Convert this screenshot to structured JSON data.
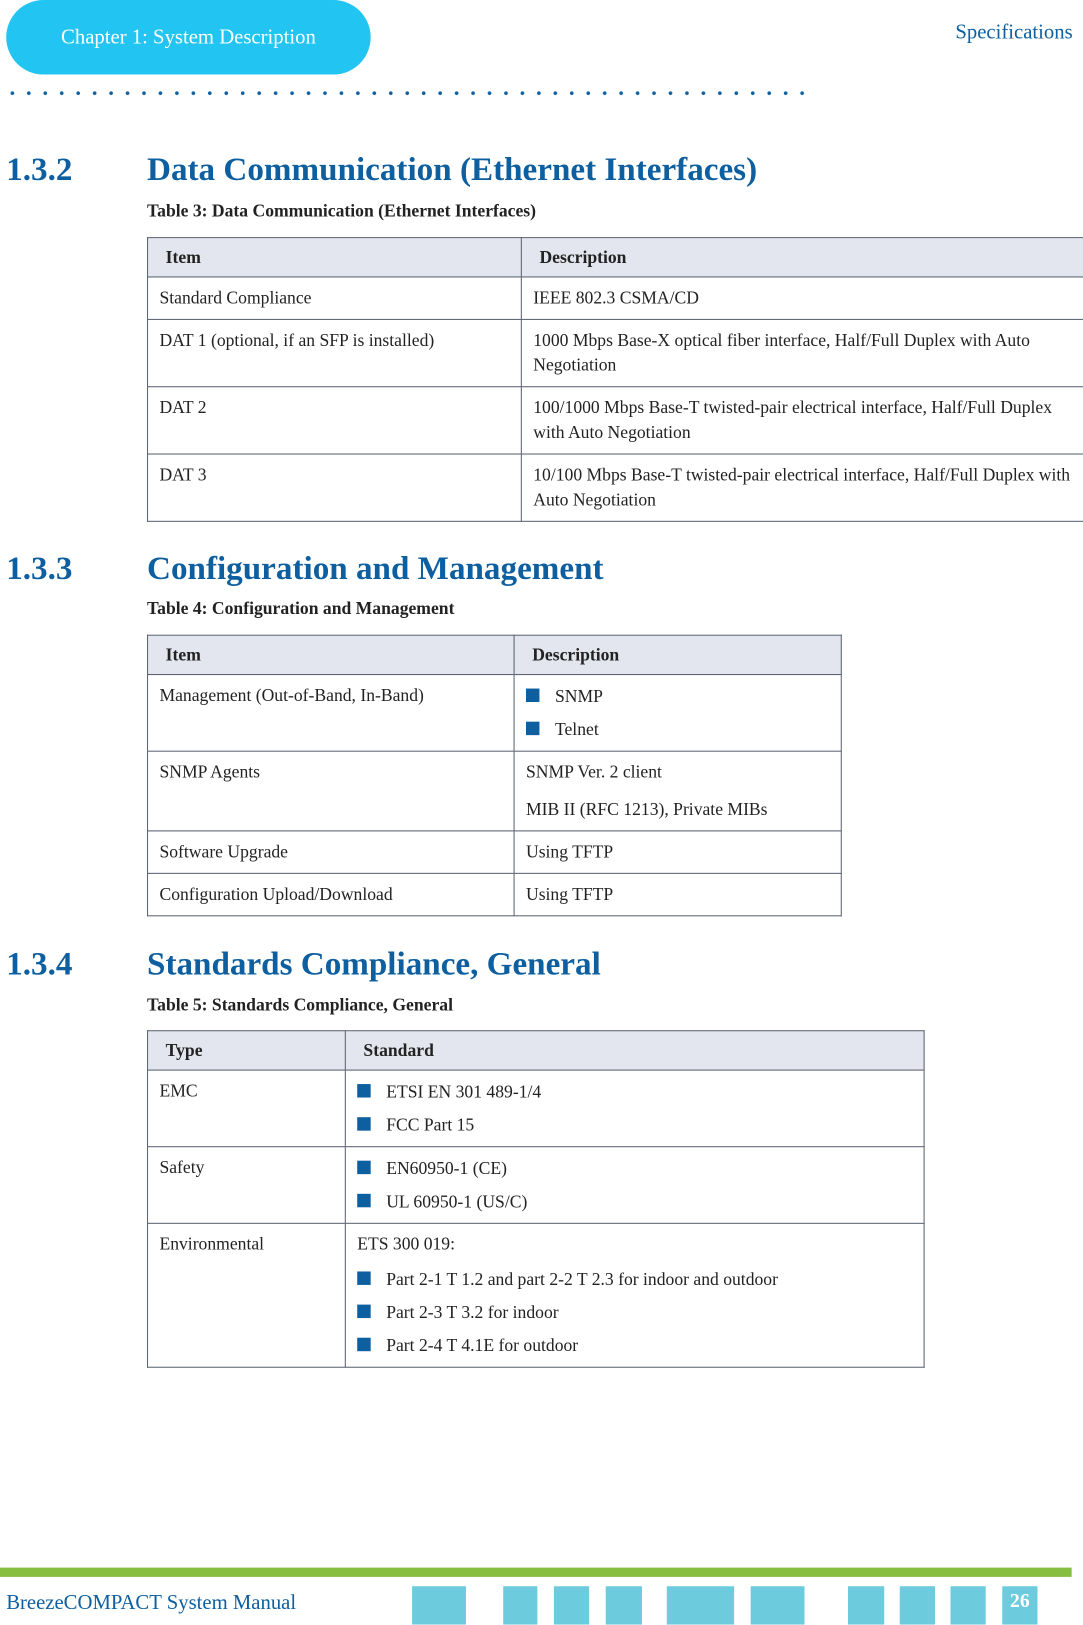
{
  "header": {
    "chapter": "Chapter 1: System Description",
    "section": "Specifications"
  },
  "sections": [
    {
      "number": "1.3.2",
      "title": "Data Communication (Ethernet Interfaces)",
      "caption": "Table 3: Data Communication (Ethernet Interfaces)",
      "headers": [
        "Item",
        "Description"
      ],
      "rows": [
        [
          "Standard Compliance",
          "IEEE 802.3 CSMA/CD"
        ],
        [
          "DAT 1 (optional, if an SFP is installed)",
          "1000 Mbps Base-X optical fiber interface, Half/Full Duplex with Auto Negotiation"
        ],
        [
          "DAT 2",
          "100/1000 Mbps Base-T twisted-pair electrical interface, Half/Full Duplex with Auto Negotiation"
        ],
        [
          "DAT 3",
          "10/100 Mbps Base-T twisted-pair electrical interface, Half/Full Duplex with Auto Negotiation"
        ]
      ]
    },
    {
      "number": "1.3.3",
      "title": "Configuration and Management",
      "caption": "Table 4: Configuration and Management",
      "headers": [
        "Item",
        "Description"
      ],
      "rows": [
        {
          "item": "Management (Out-of-Band, In-Band)",
          "bullets": [
            "SNMP",
            "Telnet"
          ]
        },
        {
          "item": "SNMP Agents",
          "lines": [
            "SNMP Ver. 2 client",
            "MIB II (RFC 1213), Private MIBs"
          ]
        },
        {
          "item": "Software Upgrade",
          "text": "Using TFTP"
        },
        {
          "item": "Configuration Upload/Download",
          "text": "Using TFTP"
        }
      ]
    },
    {
      "number": "1.3.4",
      "title": "Standards Compliance, General",
      "caption": "Table 5: Standards Compliance, General",
      "headers": [
        "Type",
        "Standard"
      ],
      "rows": [
        {
          "item": "EMC",
          "bullets": [
            "ETSI EN 301 489-1/4",
            "FCC Part 15"
          ]
        },
        {
          "item": "Safety",
          "bullets": [
            "EN60950-1 (CE)",
            "UL 60950-1 (US/C)"
          ]
        },
        {
          "item": "Environmental",
          "intro": "ETS 300 019:",
          "bullets": [
            "Part 2-1 T 1.2 and part 2-2 T 2.3 for indoor and outdoor",
            "Part 2-3 T 3.2 for indoor",
            "Part 2-4 T 4.1E for outdoor"
          ]
        }
      ]
    }
  ],
  "footer": {
    "manual": "BreezeCOMPACT System Manual",
    "page": "26"
  },
  "colors": {
    "accent": "#0d5fa0",
    "pill": "#22c4f2",
    "footer_bar": "#86bf40",
    "footer_blocks": "#6ccbdc"
  }
}
